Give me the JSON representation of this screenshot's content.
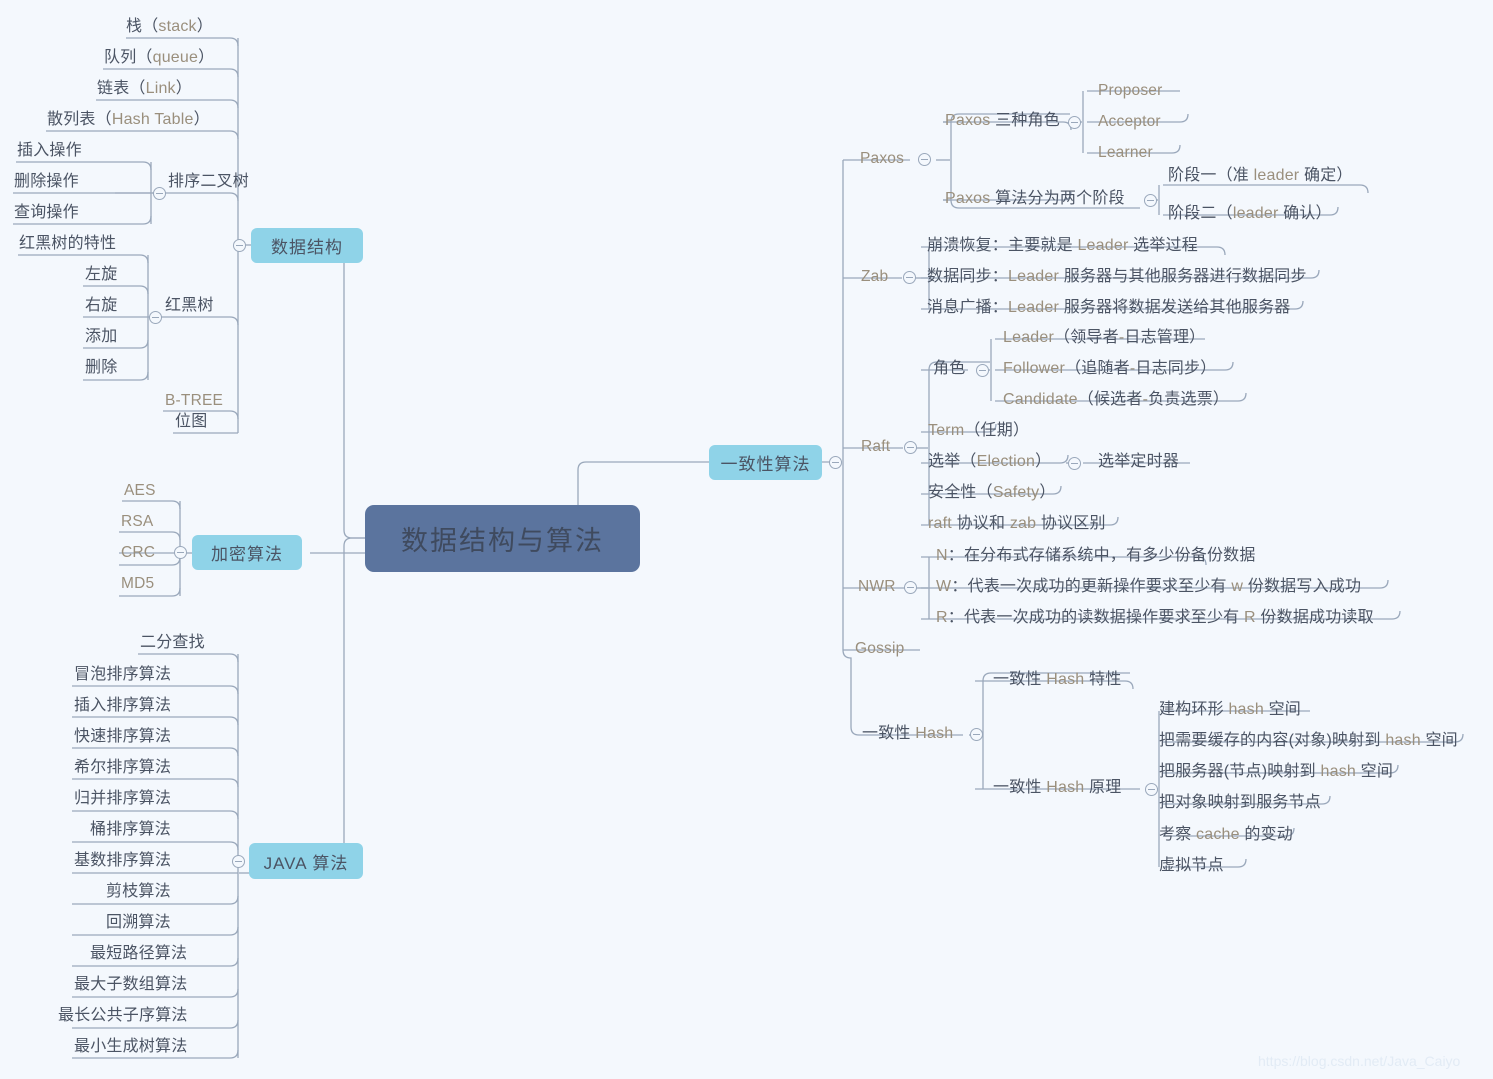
{
  "meta": {
    "background_color": "#f4f8fd",
    "root_color": "#5b749e",
    "branch_color": "#8fd3e8",
    "line_color": "#9aa8bb",
    "cjk_text_color": "#4b5464",
    "latin_text_color": "#9a8f7d",
    "watermark": "https://blog.csdn.net/Java_Caiyo"
  },
  "root": {
    "label": "数据结构与算法"
  },
  "branches": {
    "data_structure": {
      "label": "数据结构",
      "children": [
        {
          "label": "栈（stack）"
        },
        {
          "label": "队列（queue）"
        },
        {
          "label": "链表（Link）"
        },
        {
          "label": "散列表（Hash Table）"
        },
        {
          "label": "排序二叉树",
          "children": [
            {
              "label": "插入操作"
            },
            {
              "label": "删除操作"
            },
            {
              "label": "查询操作"
            }
          ]
        },
        {
          "label": "红黑树",
          "children": [
            {
              "label": "红黑树的特性"
            },
            {
              "label": "左旋"
            },
            {
              "label": "右旋"
            },
            {
              "label": "添加"
            },
            {
              "label": "删除"
            }
          ]
        },
        {
          "label": "B-TREE"
        },
        {
          "label": "位图"
        }
      ]
    },
    "encryption": {
      "label": "加密算法",
      "children": [
        {
          "label": "AES"
        },
        {
          "label": "RSA"
        },
        {
          "label": "CRC"
        },
        {
          "label": "MD5"
        }
      ]
    },
    "java_algorithms": {
      "label": "JAVA 算法",
      "children": [
        {
          "label": "二分查找"
        },
        {
          "label": "冒泡排序算法"
        },
        {
          "label": "插入排序算法"
        },
        {
          "label": "快速排序算法"
        },
        {
          "label": "希尔排序算法"
        },
        {
          "label": "归并排序算法"
        },
        {
          "label": "桶排序算法"
        },
        {
          "label": "基数排序算法"
        },
        {
          "label": "剪枝算法"
        },
        {
          "label": "回溯算法"
        },
        {
          "label": "最短路径算法"
        },
        {
          "label": "最大子数组算法"
        },
        {
          "label": "最长公共子序算法"
        },
        {
          "label": "最小生成树算法"
        }
      ]
    },
    "consistency": {
      "label": "一致性算法",
      "children": [
        {
          "label": "Paxos",
          "children": [
            {
              "label": "Paxos 三种角色",
              "children": [
                {
                  "label": "Proposer"
                },
                {
                  "label": "Acceptor"
                },
                {
                  "label": "Learner"
                }
              ]
            },
            {
              "label": "Paxos 算法分为两个阶段",
              "children": [
                {
                  "label": "阶段一（准 leader 确定）"
                },
                {
                  "label": "阶段二（leader 确认）"
                }
              ]
            }
          ]
        },
        {
          "label": "Zab",
          "children": [
            {
              "label": "崩溃恢复：主要就是 Leader 选举过程"
            },
            {
              "label": "数据同步：Leader 服务器与其他服务器进行数据同步"
            },
            {
              "label": "消息广播：Leader 服务器将数据发送给其他服务器"
            }
          ]
        },
        {
          "label": "Raft",
          "children": [
            {
              "label": "角色",
              "children": [
                {
                  "label": "Leader（领导者-日志管理）"
                },
                {
                  "label": "Follower（追随者-日志同步）"
                },
                {
                  "label": "Candidate（候选者-负责选票）"
                }
              ]
            },
            {
              "label": "Term（任期）"
            },
            {
              "label": "选举（Election）",
              "children": [
                {
                  "label": "选举定时器"
                }
              ]
            },
            {
              "label": "安全性（Safety）"
            },
            {
              "label": "raft 协议和 zab 协议区别"
            }
          ]
        },
        {
          "label": "NWR",
          "children": [
            {
              "label": "N：在分布式存储系统中，有多少份备份数据"
            },
            {
              "label": "W：代表一次成功的更新操作要求至少有 w 份数据写入成功"
            },
            {
              "label": "R：代表一次成功的读数据操作要求至少有 R 份数据成功读取"
            }
          ]
        },
        {
          "label": "Gossip"
        },
        {
          "label": "一致性 Hash",
          "children": [
            {
              "label": "一致性 Hash 特性"
            },
            {
              "label": "一致性 Hash 原理",
              "children": [
                {
                  "label": "建构环形 hash 空间"
                },
                {
                  "label": "把需要缓存的内容(对象)映射到 hash 空间"
                },
                {
                  "label": "把服务器(节点)映射到 hash 空间"
                },
                {
                  "label": "把对象映射到服务节点"
                },
                {
                  "label": "考察 cache 的变动"
                },
                {
                  "label": "虚拟节点"
                }
              ]
            }
          ]
        }
      ]
    }
  }
}
